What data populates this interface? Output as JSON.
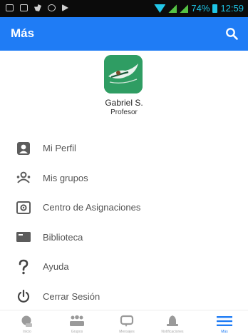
{
  "status_bar": {
    "battery": "74%",
    "time": "12:59",
    "icons": [
      "sim-icon",
      "sim-icon",
      "twitter-icon",
      "shield-icon",
      "play-icon",
      "wifi-icon",
      "signal-icon",
      "signal-icon",
      "battery-icon"
    ]
  },
  "app_bar": {
    "title": "Más",
    "search_icon": "search-icon",
    "background": "#1f7cf5"
  },
  "profile": {
    "name": "Gabriel S.",
    "role": "Profesor",
    "avatar_icon": "avatar-icon"
  },
  "menu": [
    {
      "label": "Mi Perfil",
      "icon": "profile-icon"
    },
    {
      "label": "Mis grupos",
      "icon": "groups-icon"
    },
    {
      "label": "Centro de Asignaciones",
      "icon": "assignments-icon"
    },
    {
      "label": "Biblioteca",
      "icon": "library-icon"
    },
    {
      "label": "Ayuda",
      "icon": "help-icon"
    },
    {
      "label": "Cerrar Sesión",
      "icon": "power-icon"
    }
  ],
  "bottom_nav": {
    "active_index": 4,
    "active_color": "#1f7cf5",
    "items": [
      {
        "label": "Inicio",
        "icon": "home-icon"
      },
      {
        "label": "Grupos",
        "icon": "groups-icon"
      },
      {
        "label": "Mensajes",
        "icon": "messages-icon"
      },
      {
        "label": "Notificaciones",
        "icon": "notifications-icon"
      },
      {
        "label": "Más",
        "icon": "menu-icon"
      }
    ]
  }
}
